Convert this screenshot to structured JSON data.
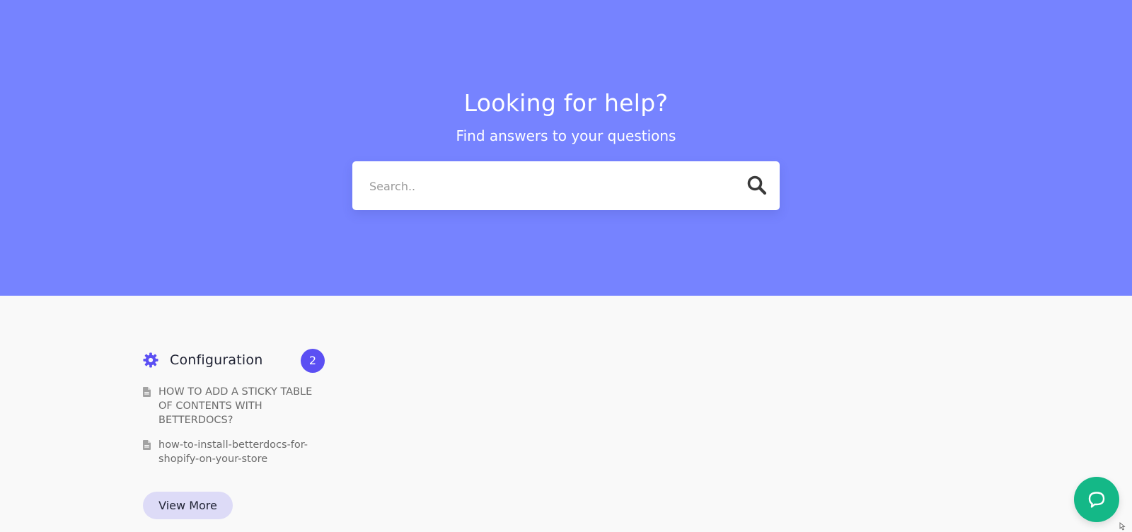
{
  "hero": {
    "title": "Looking for help?",
    "subtitle": "Find answers to your questions",
    "background_color": "#7683ff"
  },
  "search": {
    "placeholder": "Search..",
    "value": "",
    "icon": "search-icon"
  },
  "category": {
    "icon": "cog-icon",
    "title": "Configuration",
    "count": "2",
    "count_color": "#5b4ff3",
    "docs": [
      {
        "icon": "document-icon",
        "label": "HOW TO ADD A STICKY TABLE OF CONTENTS WITH BETTERDOCS?"
      },
      {
        "icon": "document-icon",
        "label": "how-to-install-betterdocs-for-shopify-on-your-store"
      }
    ],
    "view_more_label": "View More"
  },
  "chat": {
    "icon": "chat-bubble-icon",
    "color": "#14b887"
  }
}
